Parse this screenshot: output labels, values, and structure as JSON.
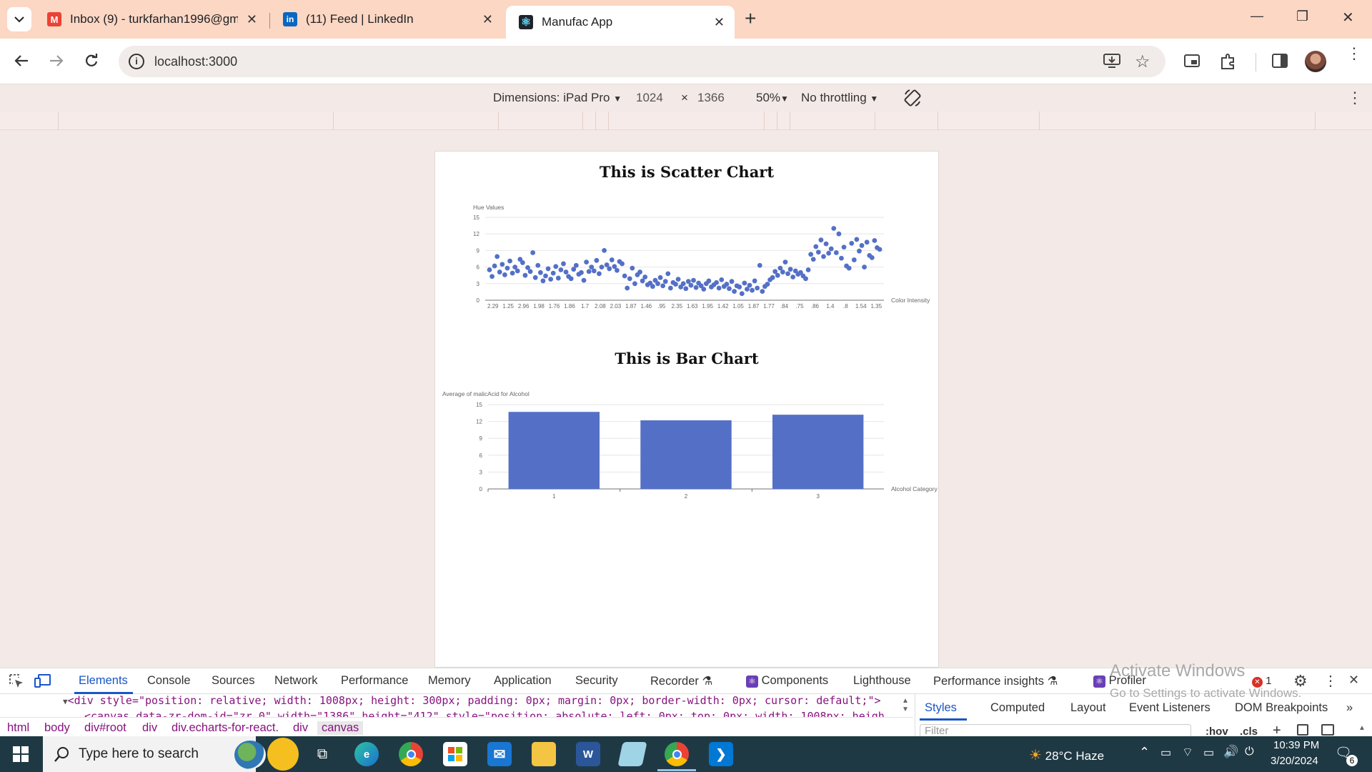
{
  "browser": {
    "tabs": [
      {
        "title": "Inbox (9) - turkfarhan1996@gm",
        "icon": "gmail-icon",
        "color": "#ea4335",
        "glyph": "M"
      },
      {
        "title": "(11) Feed | LinkedIn",
        "icon": "linkedin-icon",
        "color": "#0a66c2",
        "glyph": "in"
      },
      {
        "title": "Manufac App",
        "icon": "react-icon",
        "color": "#20232a",
        "glyph": "⚛"
      }
    ],
    "new_tab_glyph": "+",
    "window_controls": {
      "minimize": "—",
      "restore": "❐",
      "close": "✕"
    },
    "url": "localhost:3000"
  },
  "device_toolbar": {
    "dimensions_label": "Dimensions: iPad Pro",
    "width": "1024",
    "times": "×",
    "height": "1366",
    "zoom": "50%",
    "throttling": "No throttling"
  },
  "scatter_chart_title": "This is Scatter Chart",
  "bar_chart_title": "This is Bar Chart",
  "chart_data": [
    {
      "type": "scatter",
      "title": "This is Scatter Chart",
      "ylabel": "Hue Values",
      "xlabel": "Color Intensity",
      "ylim": [
        0,
        15
      ],
      "yticks": [
        0,
        3,
        6,
        9,
        12,
        15
      ],
      "xtick_labels": [
        "2.29",
        "1.25",
        "2.96",
        "1.98",
        "1.76",
        "1.86",
        "1.7",
        "2.08",
        "2.03",
        "1.87",
        "1.46",
        ".95",
        "2.35",
        "1.63",
        "1.95",
        "1.42",
        "1.05",
        "1.87",
        "1.77",
        ".84",
        ".75",
        ".86",
        "1.4",
        ".8",
        "1.54",
        "1.35"
      ],
      "color": "#5470c6",
      "values": [
        5.5,
        4.3,
        6.2,
        7.9,
        5.1,
        6.5,
        4.6,
        5.8,
        7.1,
        4.9,
        6.0,
        5.3,
        7.4,
        6.8,
        4.5,
        5.9,
        5.2,
        8.6,
        4.1,
        6.3,
        5.0,
        3.5,
        4.4,
        5.7,
        3.8,
        4.9,
        6.1,
        4.0,
        5.5,
        6.6,
        5.1,
        4.3,
        3.9,
        5.6,
        6.3,
        4.7,
        5.0,
        3.6,
        6.9,
        5.2,
        6.0,
        5.3,
        7.2,
        4.8,
        6.0,
        9.0,
        6.4,
        5.7,
        7.3,
        6.1,
        5.4,
        7.0,
        6.6,
        4.4,
        2.2,
        3.9,
        5.8,
        3.0,
        4.6,
        5.1,
        3.5,
        4.2,
        2.8,
        3.1,
        2.5,
        3.6,
        3.0,
        4.1,
        2.6,
        3.4,
        4.8,
        2.2,
        3.2,
        2.9,
        3.8,
        2.4,
        3.0,
        2.1,
        3.4,
        2.7,
        3.6,
        2.3,
        3.1,
        2.6,
        2.0,
        3.0,
        3.5,
        2.4,
        2.8,
        3.2,
        2.2,
        3.7,
        2.5,
        2.9,
        2.1,
        3.4,
        1.6,
        2.6,
        2.4,
        1.2,
        3.1,
        2.0,
        2.7,
        1.8,
        3.5,
        2.2,
        6.3,
        1.6,
        2.5,
        2.9,
        3.7,
        4.1,
        5.2,
        4.5,
        5.8,
        5.1,
        6.9,
        4.8,
        5.6,
        4.2,
        5.3,
        4.7,
        5.0,
        4.4,
        3.9,
        5.5,
        8.3,
        7.4,
        9.7,
        8.7,
        10.9,
        7.9,
        10.2,
        8.5,
        9.3,
        13.0,
        8.6,
        12.0,
        7.6,
        9.6,
        6.2,
        5.8,
        10.3,
        7.3,
        11.0,
        8.9,
        9.9,
        6.0,
        10.5,
        8.1,
        7.7,
        10.8,
        9.5,
        9.2
      ]
    },
    {
      "type": "bar",
      "title": "This is Bar Chart",
      "ylabel": "Average of malicAcid for Alcohol",
      "xlabel": "Alcohol Category",
      "categories": [
        "1",
        "2",
        "3"
      ],
      "values": [
        13.7,
        12.2,
        13.2
      ],
      "ylim": [
        0,
        15
      ],
      "yticks": [
        0,
        3,
        6,
        9,
        12,
        15
      ],
      "color": "#5470c6"
    }
  ],
  "devtools": {
    "tabs": [
      "Elements",
      "Console",
      "Sources",
      "Network",
      "Performance",
      "Memory",
      "Application",
      "Security",
      "Recorder",
      "Components",
      "Lighthouse",
      "Performance insights",
      "Profiler"
    ],
    "error_count": "1",
    "dom_line": "<div style=\"position: relative; width: 1008px; height: 300px; padding: 0px; margin: 0px; border-width: 0px; cursor: default;\">",
    "dom_line2": "<canvas data-zr-dom-id=\"zr_0\" width=\"1386\" height=\"412\" style=\"position: absolute; left: 0px; top: 0px; width: 1008px; heigh",
    "breadcrumbs": [
      "html",
      "body",
      "div#root",
      "div",
      "div.echarts-for-react.",
      "div",
      "canvas"
    ],
    "side_tabs": [
      "Styles",
      "Computed",
      "Layout",
      "Event Listeners",
      "DOM Breakpoints"
    ],
    "filter_placeholder": "Filter",
    "hov": ":hov",
    "cls": ".cls"
  },
  "watermark": {
    "line1": "Activate Windows",
    "line2": "Go to Settings to activate Windows."
  },
  "taskbar": {
    "search_placeholder": "Type here to search",
    "weather": "28°C  Haze",
    "time": "10:39 PM",
    "date": "3/20/2024",
    "notification_count": "6"
  }
}
